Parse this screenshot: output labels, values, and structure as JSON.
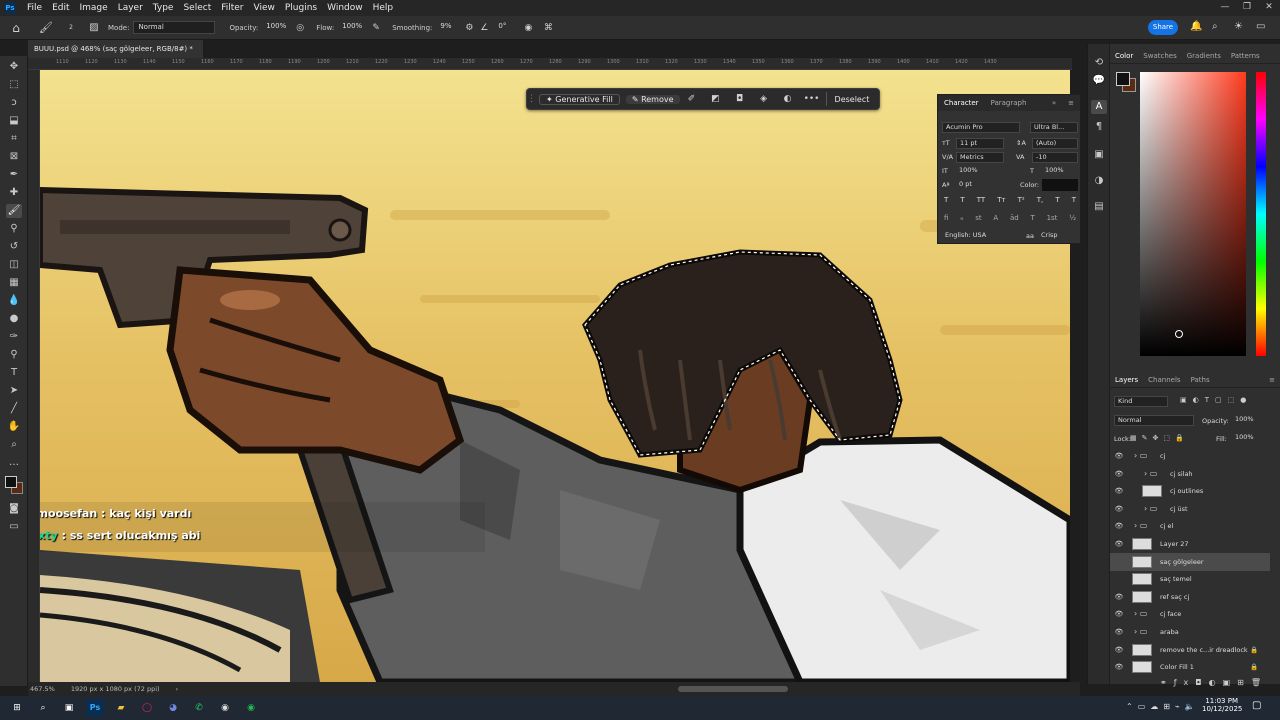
{
  "menu": {
    "items": [
      "File",
      "Edit",
      "Image",
      "Layer",
      "Type",
      "Select",
      "Filter",
      "View",
      "Plugins",
      "Window",
      "Help"
    ]
  },
  "options": {
    "mode_label": "Mode:",
    "mode_value": "Normal",
    "opacity_label": "Opacity:",
    "opacity_value": "100%",
    "flow_label": "Flow:",
    "flow_value": "100%",
    "smoothing_label": "Smoothing:",
    "smoothing_value": "9%",
    "angle_value": "0°",
    "brush_size": "2",
    "share_label": "Share"
  },
  "document": {
    "tab_title": "BUUU.psd @ 468% (saç gölgeleer, RGB/8#) *",
    "close": "×"
  },
  "ruler": {
    "ticks": [
      "1110",
      "1120",
      "1130",
      "1140",
      "1150",
      "1160",
      "1170",
      "1180",
      "1190",
      "1200",
      "1210",
      "1220",
      "1230",
      "1240",
      "1250",
      "1260",
      "1270",
      "1280",
      "1290",
      "1300",
      "1310",
      "1320",
      "1330",
      "1340",
      "1350",
      "1360",
      "1370",
      "1380",
      "1390",
      "1400",
      "1410",
      "1420",
      "1430"
    ]
  },
  "context_bar": {
    "generative_fill": "Generative Fill",
    "remove": "Remove",
    "deselect": "Deselect",
    "more": "•••"
  },
  "character_panel": {
    "tab_character": "Character",
    "tab_paragraph": "Paragraph",
    "font_family": "Acumin Pro",
    "font_style": "Ultra Bl...",
    "size": "11 pt",
    "leading": "(Auto)",
    "kerning": "Metrics",
    "tracking": "-10",
    "vscale": "100%",
    "hscale": "100%",
    "baseline": "0 pt",
    "color_label": "Color:",
    "language": "English: USA",
    "antialias": "Crisp",
    "style_buttons": [
      "T",
      "T",
      "TT",
      "Tт",
      "T²",
      "T,",
      "T",
      "T"
    ],
    "glyph_buttons": [
      "fi",
      "ℴ",
      "st",
      "A",
      "ād",
      "T",
      "1st",
      "½"
    ]
  },
  "color_panel": {
    "tabs": [
      "Color",
      "Swatches",
      "Gradients",
      "Patterns"
    ],
    "hue_color": "#ff3b1f"
  },
  "layers_panel": {
    "tabs": [
      "Layers",
      "Channels",
      "Paths"
    ],
    "kind": "Kind",
    "blend_mode": "Normal",
    "opacity_label": "Opacity:",
    "opacity_value": "100%",
    "lock_label": "Lock:",
    "fill_label": "Fill:",
    "fill_value": "100%",
    "layers": [
      {
        "name": "cj",
        "type": "group",
        "indent": 0,
        "visible": true
      },
      {
        "name": "cj silah",
        "type": "group",
        "indent": 1,
        "visible": true
      },
      {
        "name": "cj outlines",
        "type": "layer",
        "indent": 1,
        "visible": true
      },
      {
        "name": "cj üst",
        "type": "group",
        "indent": 1,
        "visible": true
      },
      {
        "name": "cj el",
        "type": "group",
        "indent": 0,
        "visible": true
      },
      {
        "name": "Layer 27",
        "type": "layer",
        "indent": 0,
        "visible": true
      },
      {
        "name": "saç gölgeleer",
        "type": "layer",
        "indent": 0,
        "visible": false,
        "selected": true
      },
      {
        "name": "saç temel",
        "type": "layer",
        "indent": 0,
        "visible": false
      },
      {
        "name": "ref saç cj",
        "type": "layer",
        "indent": 0,
        "visible": true
      },
      {
        "name": "cj face",
        "type": "group",
        "indent": 0,
        "visible": true
      },
      {
        "name": "araba",
        "type": "group",
        "indent": 0,
        "visible": true
      },
      {
        "name": "remove the c...ir dreadlock",
        "type": "layer",
        "indent": 0,
        "visible": true,
        "locked": true
      },
      {
        "name": "Color Fill 1",
        "type": "layer",
        "indent": 0,
        "visible": true,
        "locked": true
      }
    ]
  },
  "status": {
    "zoom": "467.5%",
    "doc_size": "1920 px x 1080 px (72 ppi)"
  },
  "chat": [
    {
      "user": "aquamoosefan",
      "sep": " : ",
      "msg": "kaç kişi vardı",
      "user_color": "#ffffff"
    },
    {
      "user": "sortexty",
      "sep": " : ",
      "msg": "ss sert olucakmış abi",
      "user_color": "#22d38f"
    }
  ],
  "taskbar": {
    "time": "11:03 PM",
    "date": "10/12/2025",
    "ps_label": "Ps"
  }
}
